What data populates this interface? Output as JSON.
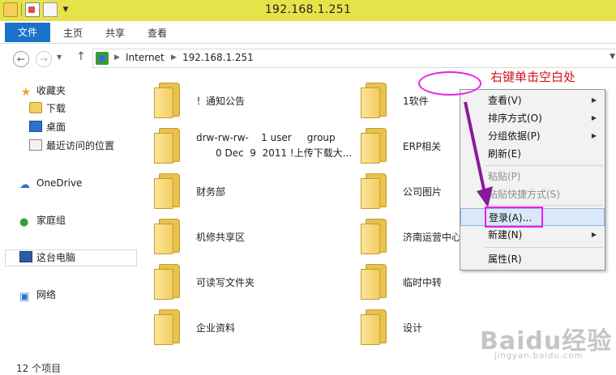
{
  "window": {
    "title": "192.168.1.251"
  },
  "ribbon": {
    "tabs": [
      "文件",
      "主页",
      "共享",
      "查看"
    ]
  },
  "address": {
    "crumbs": [
      "Internet",
      "192.168.1.251"
    ]
  },
  "navpane": {
    "favorites_header": "收藏夹",
    "favorites": [
      "下载",
      "桌面",
      "最近访问的位置"
    ],
    "onedrive": "OneDrive",
    "homegroup": "家庭组",
    "this_pc": "这台电脑",
    "network": "网络"
  },
  "files": [
    {
      "name": "！通知公告"
    },
    {
      "name": "1软件"
    },
    {
      "name": "drw-rw-rw-    1 user     group",
      "name_line2": "0 Dec  9  2011 !上传下载大..."
    },
    {
      "name": "ERP相关"
    },
    {
      "name": "财务部"
    },
    {
      "name": "公司图片"
    },
    {
      "name": "机修共享区"
    },
    {
      "name": "济南运营中心"
    },
    {
      "name": "可读写文件夹"
    },
    {
      "name": "临时中转"
    },
    {
      "name": "企业资料"
    },
    {
      "name": "设计"
    }
  ],
  "status": {
    "item_count": "12 个项目"
  },
  "context_menu": {
    "items": [
      {
        "label": "查看(V)",
        "submenu": true,
        "enabled": true
      },
      {
        "label": "排序方式(O)",
        "submenu": true,
        "enabled": true
      },
      {
        "label": "分组依据(P)",
        "submenu": true,
        "enabled": true
      },
      {
        "label": "刷新(E)",
        "submenu": false,
        "enabled": true
      },
      {
        "label": "粘贴(P)",
        "submenu": false,
        "enabled": false
      },
      {
        "label": "粘贴快捷方式(S)",
        "submenu": false,
        "enabled": false
      },
      {
        "label": "登录(A)...",
        "submenu": false,
        "enabled": true
      },
      {
        "label": "新建(N)",
        "submenu": true,
        "enabled": true
      },
      {
        "label": "属性(R)",
        "submenu": false,
        "enabled": true
      }
    ]
  },
  "annotation": {
    "text": "右键单击空白处",
    "color": "#d0121c",
    "highlight_color": "#e81ee8"
  },
  "watermark": {
    "brand": "Baidu经验",
    "url": "jingyan.baidu.com"
  },
  "colors": {
    "titlebar": "#e6e34a",
    "file_tab": "#1a73c8",
    "folder": "#f3cd61"
  }
}
